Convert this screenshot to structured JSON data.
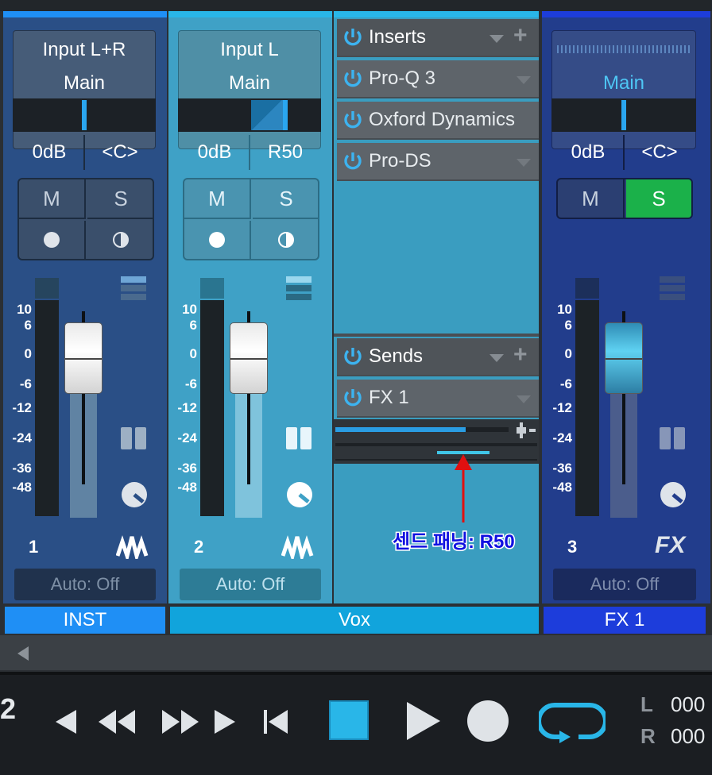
{
  "channels": [
    {
      "input": "Input L+R",
      "output": "Main",
      "volume": "0dB",
      "pan": "<C>",
      "mute": "M",
      "solo": "S",
      "number": "1",
      "auto": "Auto: Off",
      "name": "INST",
      "fader_db": 0
    },
    {
      "input": "Input L",
      "output": "Main",
      "volume": "0dB",
      "pan": "R50",
      "mute": "M",
      "solo": "S",
      "number": "2",
      "auto": "Auto: Off",
      "name": "Vox",
      "fader_db": 0
    },
    {
      "input": "",
      "output": "Main",
      "volume": "0dB",
      "pan": "<C>",
      "mute": "M",
      "solo": "S",
      "solo_active": true,
      "number": "3",
      "type_label": "FX",
      "auto": "Auto: Off",
      "name": "FX 1",
      "fader_db": 0
    }
  ],
  "scale_labels": [
    "10",
    "6",
    "0",
    "-6",
    "-12",
    "-24",
    "-36",
    "-48"
  ],
  "inserts": {
    "header": "Inserts",
    "items": [
      "Pro-Q 3",
      "Oxford Dynamics",
      "Pro-DS"
    ]
  },
  "sends": {
    "header": "Sends",
    "items": [
      "FX 1"
    ],
    "send_level": 0.75,
    "send_pan": "R50"
  },
  "annotation": {
    "text": "센드 패닝: R50",
    "color": "#1010e0",
    "arrow_color": "#e01010"
  },
  "transport": {
    "left_number": "2",
    "loop_left_label": "L",
    "loop_right_label": "R",
    "loop_left_value": "000",
    "loop_right_value": "000"
  },
  "colors": {
    "accent": "#29b6e8",
    "solo_on": "#1bb14a",
    "inst_color": "#1f8ff5",
    "fx_color": "#1d3ddb"
  }
}
